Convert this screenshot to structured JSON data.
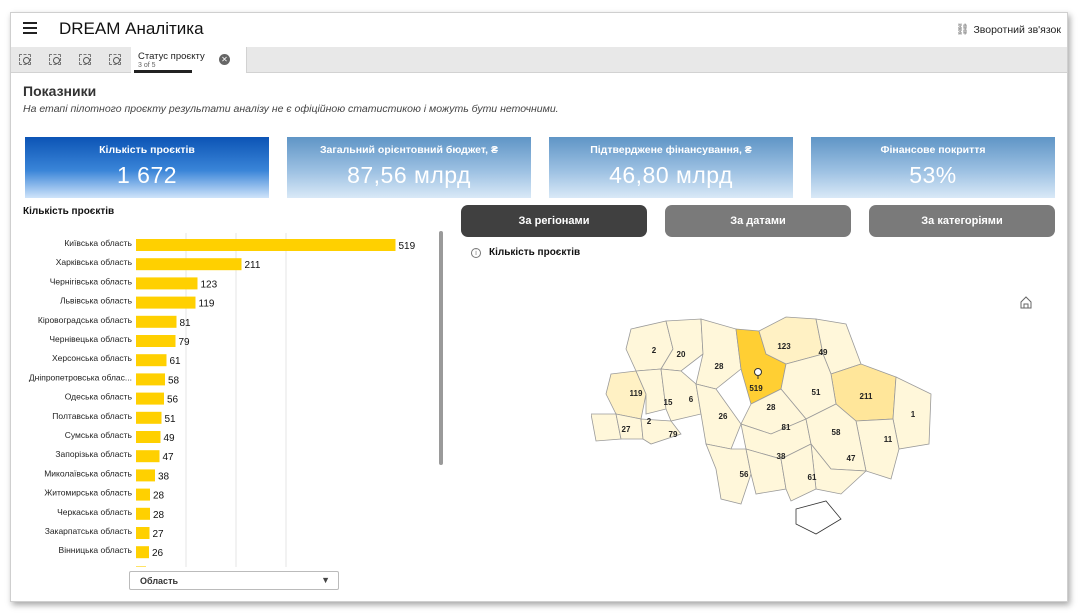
{
  "app": {
    "title": "DREAM Аналітика",
    "feedback": "Зворотний зв'язок"
  },
  "toolbar": {
    "tab": {
      "title": "Статус проєкту",
      "subtitle": "3 of 5"
    },
    "icons": [
      "smart-search-icon",
      "step-back-icon",
      "step-forward-icon",
      "clear-selections-icon"
    ]
  },
  "page": {
    "heading": "Показники",
    "disclaimer": "На етапі пілотного проєкту результати аналізу не є офіційною статистикою і можуть бути неточними."
  },
  "kpis": [
    {
      "label": "Кількість проєктів",
      "value": "1 672"
    },
    {
      "label": "Загальний орієнтовний бюджет, ₴",
      "value": "87,56 млрд"
    },
    {
      "label": "Підтверджене фінансування, ₴",
      "value": "46,80 млрд"
    },
    {
      "label": "Фінансове покриття",
      "value": "53%"
    }
  ],
  "colors": {
    "accent": "#0c54b5",
    "bar": "#ffd000",
    "map_high": "#ffcf33",
    "map_mid": "#ffe69a",
    "map_low": "#fff7da"
  },
  "chart_data": {
    "type": "bar",
    "orientation": "horizontal",
    "title": "Кількість проєктів",
    "categories": [
      "Київська область",
      "Харківська область",
      "Чернігівська область",
      "Львівська область",
      "Кіровоградська область",
      "Чернівецька область",
      "Херсонська область",
      "Дніпропетровська облас...",
      "Одеська область",
      "Полтавська область",
      "Сумська область",
      "Запорізька область",
      "Миколаївська область",
      "Житомирська область",
      "Черкаська область",
      "Закарпатська область",
      "Вінницька область"
    ],
    "values": [
      519,
      211,
      123,
      119,
      81,
      79,
      61,
      58,
      56,
      51,
      49,
      47,
      38,
      28,
      28,
      27,
      26
    ],
    "xlim": [
      0,
      600
    ],
    "grid": true
  },
  "filters": {
    "dimension": "Область"
  },
  "view_buttons": [
    {
      "label": "За регіонами"
    },
    {
      "label": "За датами"
    },
    {
      "label": "За категоріями"
    }
  ],
  "map": {
    "title": "Кількість проєктів",
    "labels": [
      "123",
      "49",
      "2",
      "20",
      "28",
      "519",
      "51",
      "211",
      "119",
      "15",
      "6",
      "28",
      "26",
      "1",
      "27",
      "2",
      "79",
      "81",
      "58",
      "11",
      "38",
      "47",
      "56",
      "61"
    ]
  }
}
